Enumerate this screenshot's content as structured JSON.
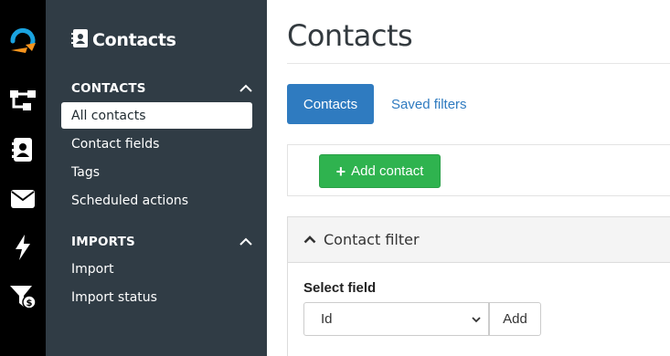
{
  "rail": {
    "icons": [
      "logo-icon",
      "workflow-icon",
      "contacts-icon",
      "email-icon",
      "lightning-icon",
      "funnel-dollar-icon"
    ]
  },
  "sidebar": {
    "title": "Contacts",
    "sections": [
      {
        "label": "CONTACTS",
        "items": [
          {
            "label": "All contacts",
            "active": true
          },
          {
            "label": "Contact fields"
          },
          {
            "label": "Tags"
          },
          {
            "label": "Scheduled actions"
          }
        ]
      },
      {
        "label": "IMPORTS",
        "items": [
          {
            "label": "Import"
          },
          {
            "label": "Import status"
          }
        ]
      }
    ]
  },
  "main": {
    "title": "Contacts",
    "tabs": [
      {
        "label": "Contacts",
        "active": true
      },
      {
        "label": "Saved filters"
      }
    ],
    "toolbar": {
      "add_contact_label": "Add contact"
    },
    "filter": {
      "title": "Contact filter",
      "field_label": "Select field",
      "select_value": "Id",
      "add_label": "Add"
    }
  },
  "colors": {
    "rail_bg": "#000000",
    "sidebar_bg": "#303c45",
    "primary": "#2f7bc0",
    "success": "#2fb34f",
    "logo_blue": "#1aa3e0",
    "logo_orange": "#f7941d"
  }
}
